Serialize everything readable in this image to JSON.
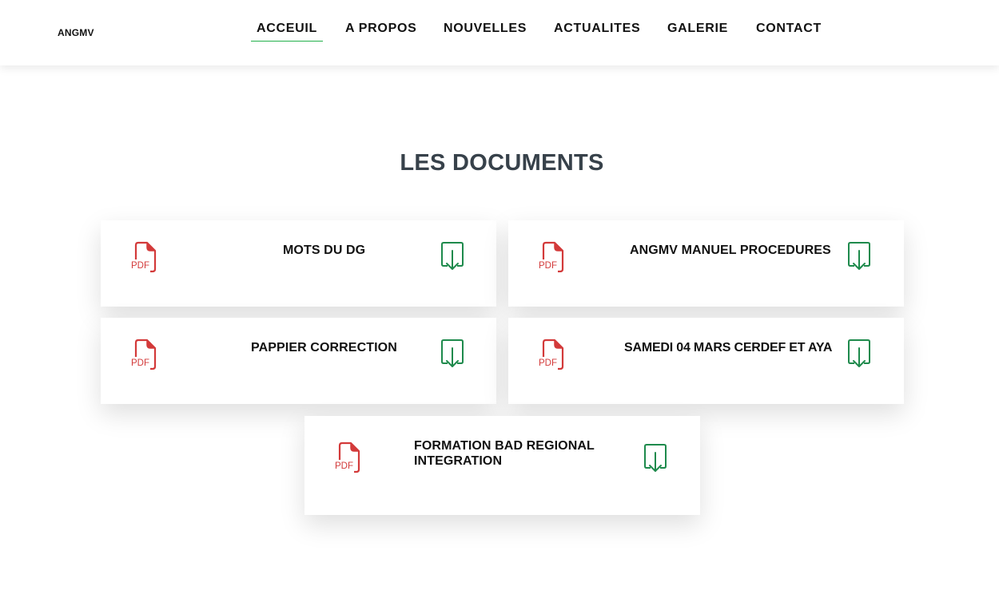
{
  "header": {
    "logo": "ANGMV",
    "nav": [
      {
        "label": "ACCEUIL",
        "active": true
      },
      {
        "label": "A PROPOS",
        "active": false
      },
      {
        "label": "NOUVELLES",
        "active": false
      },
      {
        "label": "ACTUALITES",
        "active": false
      },
      {
        "label": "GALERIE",
        "active": false
      },
      {
        "label": "CONTACT",
        "active": false
      }
    ]
  },
  "main": {
    "title": "LES DOCUMENTS",
    "documents": [
      {
        "title": "MOTS DU DG",
        "file_icon": "pdf-file-icon",
        "file_badge": "PDF",
        "action_icon": "download-icon"
      },
      {
        "title": "ANGMV MANUEL PROCEDURES",
        "file_icon": "pdf-file-icon",
        "file_badge": "PDF",
        "action_icon": "download-icon"
      },
      {
        "title": "PAPPIER CORRECTION",
        "file_icon": "pdf-file-icon",
        "file_badge": "PDF",
        "action_icon": "download-icon"
      },
      {
        "title": "SAMEDI 04 MARS CERDEF ET AYA",
        "file_icon": "pdf-file-icon",
        "file_badge": "PDF",
        "action_icon": "download-icon"
      },
      {
        "title": "FORMATION BAD REGIONAL INTEGRATION",
        "file_icon": "pdf-file-icon",
        "file_badge": "PDF",
        "action_icon": "download-icon"
      }
    ]
  },
  "colors": {
    "accent_green": "#22b04b",
    "pdf_red": "#d33a3a",
    "download_green": "#1e8a4c",
    "title_gray": "#37414a"
  }
}
